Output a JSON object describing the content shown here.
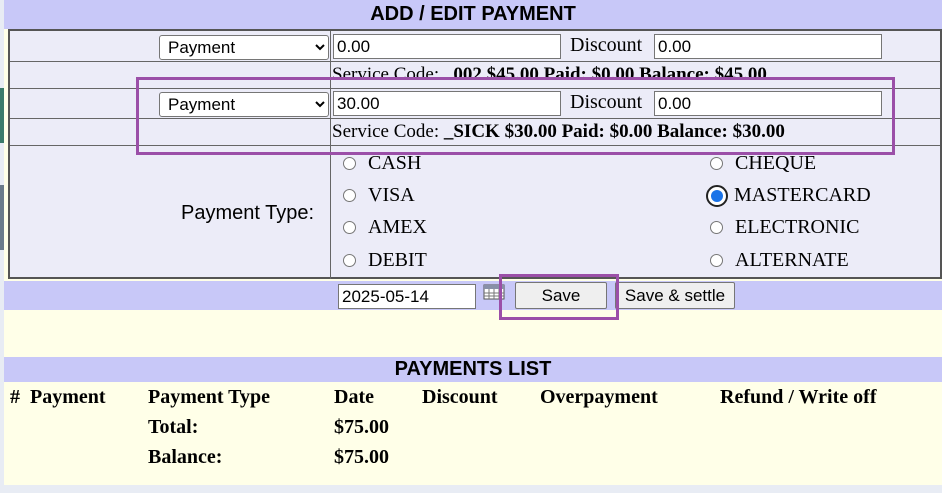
{
  "header": {
    "title": "ADD / EDIT PAYMENT"
  },
  "rows": [
    {
      "type_value": "Payment",
      "amount": "0.00",
      "discount_label": "Discount",
      "discount": "0.00",
      "service_label": "Service Code:",
      "service_code": "_002",
      "service_amount": "$45.00",
      "paid_label": "Paid:",
      "paid": "$0.00",
      "balance_label": "Balance:",
      "balance": "$45.00"
    },
    {
      "type_value": "Payment",
      "amount": "30.00",
      "discount_label": "Discount",
      "discount": "0.00",
      "service_label": "Service Code:",
      "service_code": "_SICK",
      "service_amount": "$30.00",
      "paid_label": "Paid:",
      "paid": "$0.00",
      "balance_label": "Balance:",
      "balance": "$30.00"
    }
  ],
  "payment_type": {
    "label": "Payment Type:",
    "options": [
      "CASH",
      "CHEQUE",
      "VISA",
      "MASTERCARD",
      "AMEX",
      "ELECTRONIC",
      "DEBIT",
      "ALTERNATE"
    ],
    "selected": "MASTERCARD"
  },
  "actions": {
    "date": "2025-05-14",
    "save_label": "Save",
    "save_settle_label": "Save & settle"
  },
  "payments_list": {
    "title": "PAYMENTS LIST",
    "columns": [
      "#",
      "Payment",
      "Payment Type",
      "Date",
      "Discount",
      "Overpayment",
      "Refund / Write off"
    ],
    "total_label": "Total:",
    "total_value": "$75.00",
    "balance_label": "Balance:",
    "balance_value": "$75.00"
  },
  "colors": {
    "header_bg": "#c8c8f8",
    "form_bg": "#ececf8",
    "page_bg": "#ffffe8",
    "highlight": "#9b4fa8",
    "radio_selected": "#1a73e8"
  }
}
